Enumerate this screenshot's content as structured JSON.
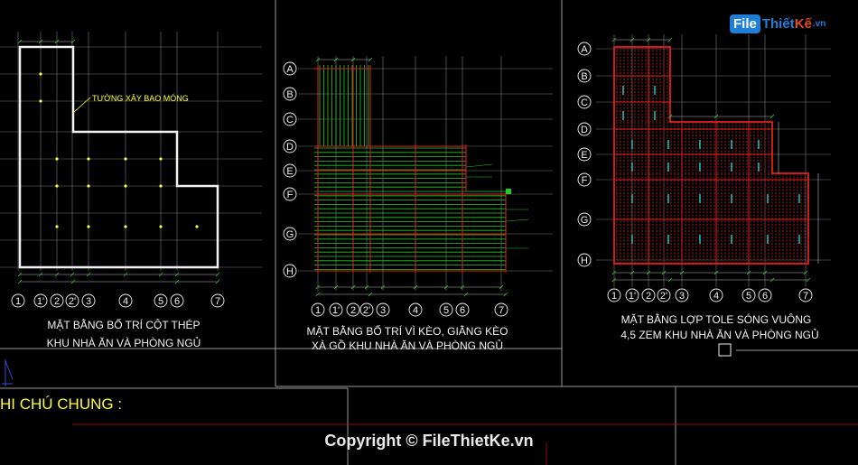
{
  "panels": [
    {
      "id": "p1",
      "caption1": "MẶT BẰNG BỐ TRÍ CỘT THÉP",
      "caption2": "KHU NHÀ ĂN VÀ PHÒNG NGỦ",
      "annotation": "TƯỜNG XÂY BAO MÓNG",
      "axes_h": [
        "1",
        "1'",
        "2",
        "2'",
        "3",
        "4",
        "5",
        "6",
        "7"
      ],
      "axes_v": []
    },
    {
      "id": "p2",
      "caption1": "MẶT BẰNG BỐ TRÍ VÌ KÈO, GIẰNG KÈO",
      "caption2": "XÀ GỒ KHU NHÀ ĂN VÀ PHÒNG NGỦ",
      "axes_h": [
        "1",
        "1'",
        "2",
        "2'",
        "3",
        "4",
        "5",
        "6",
        "7"
      ],
      "axes_v": [
        "A",
        "B",
        "C",
        "D",
        "E",
        "F",
        "G",
        "H"
      ]
    },
    {
      "id": "p3",
      "caption1": "MẶT BẰNG LỢP TOLE SÓNG VUÔNG",
      "caption2": "4,5 ZEM KHU NHÀ ĂN VÀ PHÒNG NGỦ",
      "axes_h": [
        "1",
        "1'",
        "2",
        "2'",
        "3",
        "4",
        "5",
        "6",
        "7"
      ],
      "axes_v": [
        "A",
        "B",
        "C",
        "D",
        "E",
        "F",
        "G",
        "H"
      ]
    }
  ],
  "notes_title": "HI CHÚ CHUNG :",
  "copyright": "Copyright © FileThietKe.vn",
  "logo": {
    "part1": "File",
    "part2": "Thiết",
    "part3": "Kế",
    "part4": ".vn"
  },
  "colors": {
    "background": "#000000",
    "grid": "#7a7a7a",
    "axis_text": "#f2f2f2",
    "wall": "#f2f2f2",
    "beam_red": "#e02020",
    "truss_green": "#22cc22",
    "note_yellow": "#ffff33",
    "hatch_cyan": "#22cccc"
  }
}
